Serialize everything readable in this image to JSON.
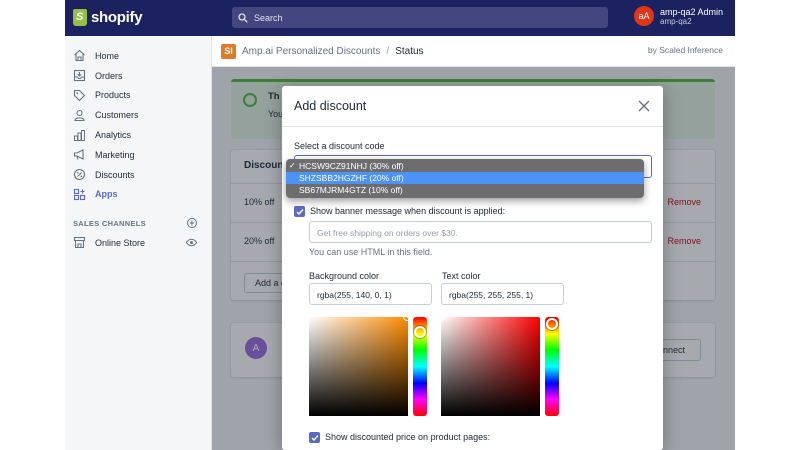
{
  "topbar": {
    "logo_text": "shopify",
    "search_placeholder": "Search",
    "user_initials": "aA",
    "user_name": "amp-qa2 Admin",
    "user_store": "amp-qa2"
  },
  "sidebar": {
    "items": [
      {
        "label": "Home",
        "icon": "home-icon"
      },
      {
        "label": "Orders",
        "icon": "orders-icon"
      },
      {
        "label": "Products",
        "icon": "tag-icon"
      },
      {
        "label": "Customers",
        "icon": "person-icon"
      },
      {
        "label": "Analytics",
        "icon": "bar-chart-icon"
      },
      {
        "label": "Marketing",
        "icon": "megaphone-icon"
      },
      {
        "label": "Discounts",
        "icon": "discount-icon"
      },
      {
        "label": "Apps",
        "icon": "apps-icon",
        "active": true
      }
    ],
    "channels_label": "SALES CHANNELS",
    "online_store": "Online Store"
  },
  "appbar": {
    "logo": "SI",
    "app_name": "Amp.ai Personalized Discounts",
    "separator": "/",
    "page": "Status",
    "by": "by Scaled Inference"
  },
  "background": {
    "banner_title": "Th",
    "banner_text": "You",
    "card_title": "Discoun",
    "rows": [
      {
        "pct": "10% off",
        "remove": "Remove"
      },
      {
        "pct": "20% off",
        "remove": "Remove"
      }
    ],
    "add_button": "Add a d",
    "avatar": "A",
    "connect": "onnect"
  },
  "modal": {
    "title": "Add discount",
    "select_label": "Select a discount code",
    "options": [
      {
        "label": "HCSW9CZ91NHJ (30% off)",
        "checked": true,
        "highlighted": false
      },
      {
        "label": "SHZSBB2HGZHF (20% off)",
        "checked": false,
        "highlighted": true
      },
      {
        "label": "SB67MJRM4GTZ (10% off)",
        "checked": false,
        "highlighted": false
      }
    ],
    "banner_checkbox": "Show banner message when discount is applied:",
    "banner_placeholder": "Get free shipping on orders over $30.",
    "banner_help": "You can use HTML in this field.",
    "bg_color_label": "Background color",
    "bg_color_value": "rgba(255, 140, 0, 1)",
    "text_color_label": "Text color",
    "text_color_value": "rgba(255, 255, 255, 1)",
    "price_checkbox": "Show discounted price on product pages:"
  },
  "colors": {
    "topbar": "#1c2260",
    "accent": "#5c6ac4",
    "bg_hue": "#ff8c00",
    "text_hue": "#ff0000",
    "remove": "#bf0711"
  }
}
